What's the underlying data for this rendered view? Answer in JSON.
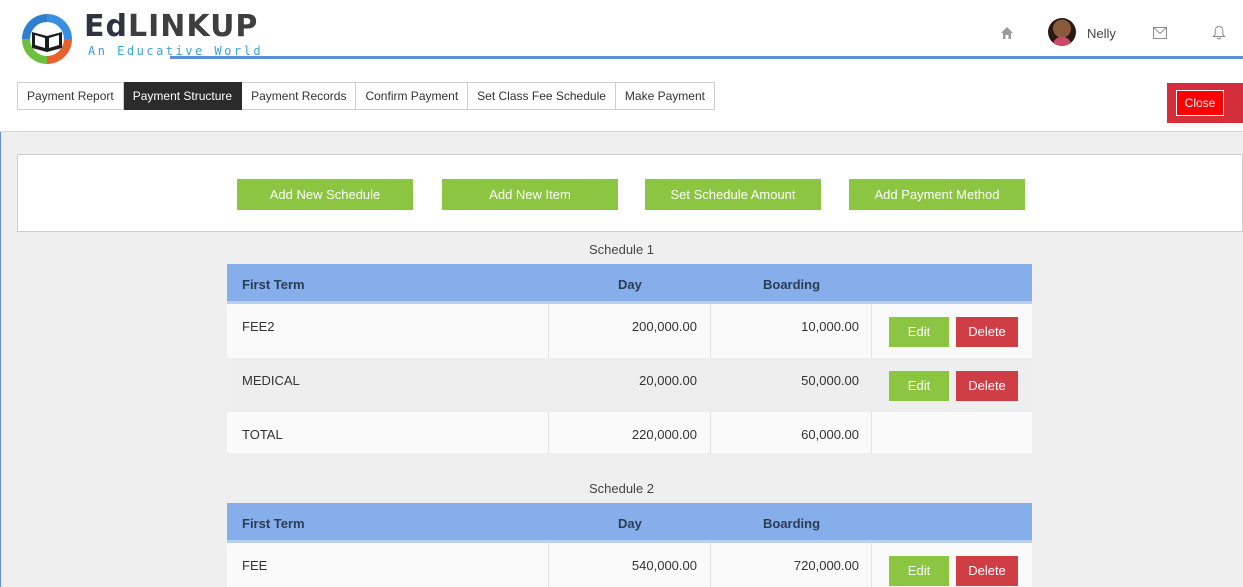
{
  "brand": {
    "name": "EdLINKUP",
    "name_ed": "Ed",
    "name_rest": "LINKUP",
    "tagline": "An Educative World"
  },
  "header": {
    "user_name": "Nelly",
    "icons": [
      "home-icon",
      "mail-icon",
      "bell-icon"
    ]
  },
  "tabs": [
    {
      "label": "Payment Report",
      "active": false
    },
    {
      "label": "Payment Structure",
      "active": true
    },
    {
      "label": "Payment Records",
      "active": false
    },
    {
      "label": "Confirm Payment",
      "active": false
    },
    {
      "label": "Set Class Fee Schedule",
      "active": false
    },
    {
      "label": "Make Payment",
      "active": false
    }
  ],
  "close_label": "Close",
  "actions": {
    "add_schedule": "Add New Schedule",
    "add_item": "Add New Item",
    "set_amount": "Set Schedule Amount",
    "add_method": "Add Payment Method"
  },
  "schedules": [
    {
      "title": "Schedule 1",
      "columns": {
        "term": "First Term",
        "day": "Day",
        "boarding": "Boarding"
      },
      "rows": [
        {
          "name": "FEE2",
          "day": "200,000.00",
          "boarding": "10,000.00",
          "edit": "Edit",
          "delete": "Delete"
        },
        {
          "name": "MEDICAL",
          "day": "20,000.00",
          "boarding": "50,000.00",
          "edit": "Edit",
          "delete": "Delete"
        },
        {
          "name": "TOTAL",
          "day": "220,000.00",
          "boarding": "60,000.00"
        }
      ]
    },
    {
      "title": "Schedule 2",
      "columns": {
        "term": "First Term",
        "day": "Day",
        "boarding": "Boarding"
      },
      "rows": [
        {
          "name": "FEE",
          "day": "540,000.00",
          "boarding": "720,000.00",
          "edit": "Edit",
          "delete": "Delete"
        }
      ]
    }
  ],
  "colors": {
    "accent_green": "#8cc541",
    "danger_red": "#cf3d45",
    "header_blue": "#85aeeb",
    "close_red": "#ff0000"
  }
}
